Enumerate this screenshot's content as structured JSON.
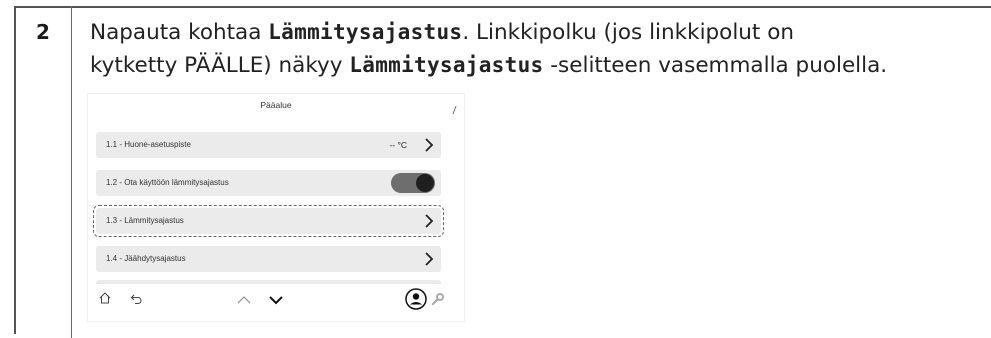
{
  "step": {
    "number": "2"
  },
  "instruction": {
    "line1_pre": "Napauta kohtaa ",
    "line1_code": "Lämmitysajastus",
    "line1_post": ". Linkkipolku (jos linkkipolut on",
    "line2_pre": "kytketty PÄÄLLE) näkyy ",
    "line2_code": "Lämmitysajastus",
    "line2_post": " -selitteen vasemmalla puolella."
  },
  "screen": {
    "title": "Pääalue",
    "rows": [
      {
        "label": "1.1 - Huone-asetuspiste",
        "value": "-- °C"
      },
      {
        "label": "1.2 - Ota käyttöön lämmitysajastus",
        "toggle_on": true
      },
      {
        "label": "1.3 - Lämmitysajastus",
        "selected": true
      },
      {
        "label": "1.4 - Jäähdytysajastus"
      }
    ],
    "bottom_icons": [
      "home-icon",
      "back-icon",
      "chevron-up-icon",
      "chevron-down-icon",
      "user-icon",
      "wrench-icon"
    ]
  }
}
